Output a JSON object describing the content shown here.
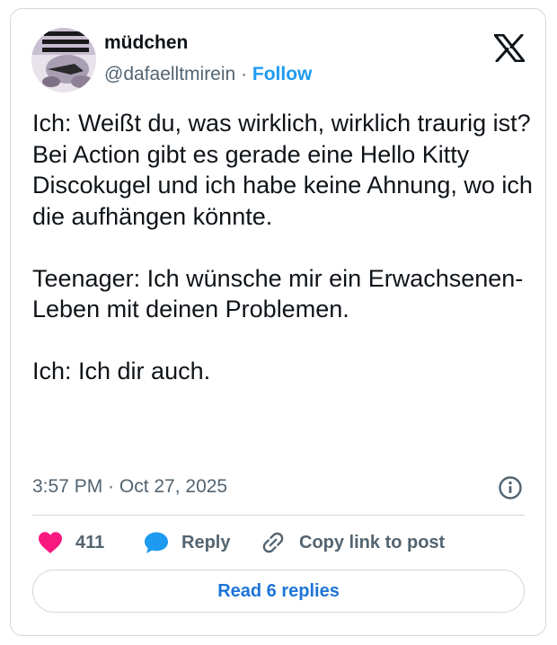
{
  "author": {
    "display_name": "müdchen",
    "handle": "@dafaelltmirein",
    "separator": "·",
    "follow_label": "Follow"
  },
  "tweet": {
    "text": "Ich: Weißt du, was wirklich, wirklich traurig ist?\nBei Action gibt es gerade eine Hello Kitty Discokugel und ich habe keine Ahnung, wo ich die aufhängen könnte.\n\nTeenager: Ich wünsche mir ein Erwachsenen-Leben mit deinen Problemen.\n\nIch: Ich dir auch.",
    "timestamp": "3:57 PM · Oct 27, 2025"
  },
  "actions": {
    "like_count": "411",
    "reply_label": "Reply",
    "copy_link_label": "Copy link to post"
  },
  "read_replies_label": "Read 6 replies",
  "icons": {
    "platform": "x-logo-icon",
    "info": "info-icon",
    "like": "heart-icon",
    "reply": "speech-bubble-icon",
    "copy": "link-icon"
  },
  "colors": {
    "accent": "#1d9bf0",
    "like": "#f91880",
    "reply_icon": "#1d9bf0",
    "secondary_text": "#536471",
    "border": "#cfd9de"
  }
}
